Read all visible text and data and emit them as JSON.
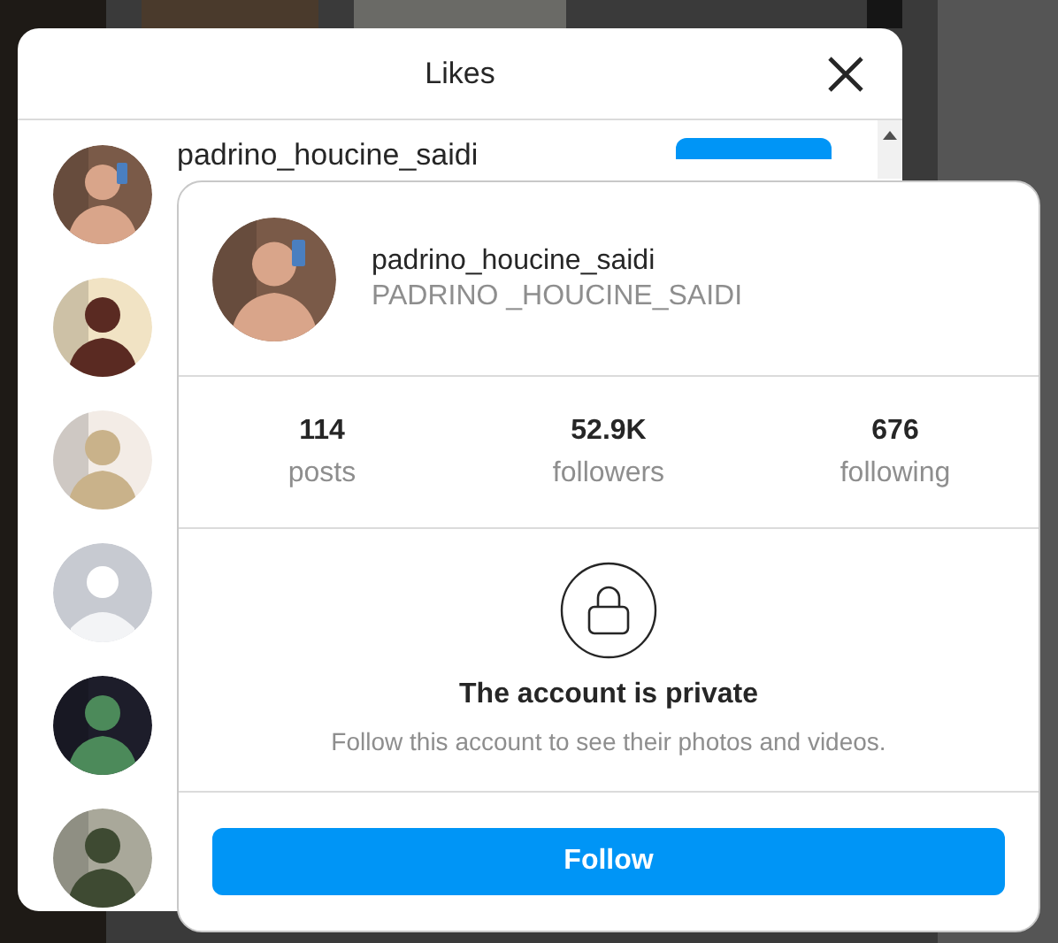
{
  "likes_dialog": {
    "title": "Likes",
    "rows": [
      {
        "avatar": {
          "kind": "picture"
        },
        "username": "padrino_houcine_saidi",
        "has_button": true
      },
      {
        "avatar": {
          "kind": "picture"
        }
      },
      {
        "avatar": {
          "kind": "picture"
        }
      },
      {
        "avatar": {
          "kind": "default"
        }
      },
      {
        "avatar": {
          "kind": "picture"
        }
      },
      {
        "avatar": {
          "kind": "picture"
        }
      }
    ]
  },
  "profile_card": {
    "avatar": {
      "kind": "picture"
    },
    "username": "padrino_houcine_saidi",
    "full_name": "PADRINO _HOUCINE_SAIDI",
    "stats": [
      {
        "value": "114",
        "label": "posts"
      },
      {
        "value": "52.9K",
        "label": "followers"
      },
      {
        "value": "676",
        "label": "following"
      }
    ],
    "private_title": "The account is private",
    "private_text": "Follow this account to see their photos and videos.",
    "button": "Follow"
  }
}
